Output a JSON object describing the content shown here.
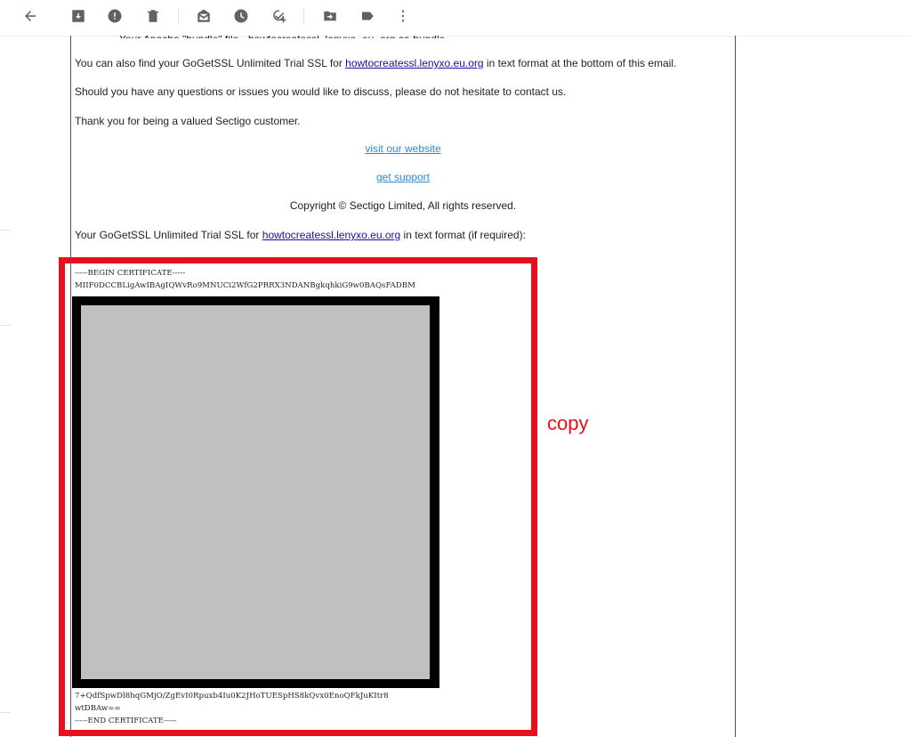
{
  "toolbar": {
    "icons": [
      "back-arrow-icon",
      "archive-icon",
      "report-spam-icon",
      "delete-icon",
      "mark-unread-icon",
      "snooze-icon",
      "add-task-icon",
      "move-to-icon",
      "label-icon",
      "more-vert-icon"
    ]
  },
  "email": {
    "cut_line": "Your Apache \"bundle\" file - howtocreatessl_lenyxo_eu_org.ca-bundle",
    "para_find_prefix": "You can also find your GoGetSSL Unlimited Trial SSL for ",
    "para_find_link": "howtocreatessl.lenyxo.eu.org",
    "para_find_suffix": " in text format at the bottom of this email.",
    "para_questions": "Should you have any questions or issues you would like to discuss, please do not hesitate to contact us.",
    "para_thanks": "Thank you for being a valued Sectigo customer.",
    "link_website": "visit our website",
    "link_support": "get support",
    "copyright": "Copyright © Sectigo Limited, All rights reserved.",
    "para_text_prefix": "Your GoGetSSL Unlimited Trial SSL for ",
    "para_text_link": "howtocreatessl.lenyxo.eu.org",
    "para_text_suffix": " in text format (if required):"
  },
  "certificate": {
    "begin": "-----BEGIN CERTIFICATE-----",
    "line1": "MIIF0DCCBLigAwIBAgIQWvRo9MNUCi2WfG2PRRX3NDANBgkqhkiG9w0BAQsFADBM",
    "line_last1": "7+QdfSpwDl8hqGMjO/ZgEvI0Rpuxb4Iu0K2JHoTUESpHS8kQvx0EnoQFkJuKItr8",
    "line_last2": "wtDBAw==",
    "end": "-----END CERTIFICATE-----"
  },
  "annotation": {
    "label": "copy",
    "color": "#e8101e"
  }
}
